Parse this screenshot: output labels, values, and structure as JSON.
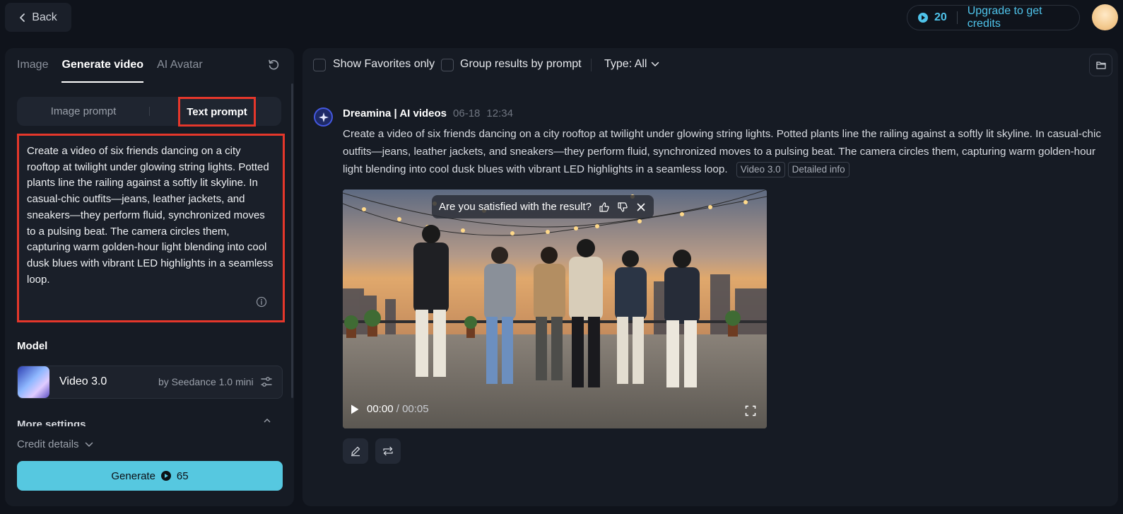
{
  "topbar": {
    "back_label": "Back",
    "credits": "20",
    "upgrade_label": "Upgrade to get credits"
  },
  "left": {
    "tabs": [
      {
        "label": "Image"
      },
      {
        "label": "Generate video"
      },
      {
        "label": "AI Avatar"
      }
    ],
    "prompt_modes": {
      "image": "Image prompt",
      "text": "Text prompt"
    },
    "prompt_value": "Create a video of six friends dancing on a city rooftop at twilight under glowing string lights. Potted plants line the railing against a softly lit skyline. In casual-chic outfits—jeans, leather jackets, and sneakers—they perform fluid, synchronized moves to a pulsing beat. The camera circles them, capturing warm golden-hour light blending into cool dusk blues with vibrant LED highlights in a seamless loop.",
    "model_label": "Model",
    "model": {
      "name": "Video 3.0",
      "by": "by Seedance 1.0 mini"
    },
    "more_settings": "More settings",
    "credit_details": "Credit details",
    "generate_label": "Generate",
    "generate_cost": "65"
  },
  "right": {
    "filters": {
      "favorites": "Show Favorites only",
      "group": "Group results by prompt",
      "type": "Type: All"
    },
    "post": {
      "author": "Dreamina | AI videos",
      "date": "06-18",
      "time": "12:34",
      "text": "Create a video of six friends dancing on a city rooftop at twilight under glowing string lights. Potted plants line the railing against a softly lit skyline. In casual-chic outfits—jeans, leather jackets, and sneakers—they perform fluid, synchronized moves to a pulsing beat. The camera circles them, capturing warm golden-hour light blending into cool dusk blues with vibrant LED highlights in a seamless loop.",
      "tag_model": "Video 3.0",
      "tag_info": "Detailed info"
    },
    "video": {
      "feedback_question": "Are you satisfied with the result?",
      "time_current": "00:00",
      "time_sep": " / ",
      "time_total": "00:05"
    }
  },
  "colors": {
    "accent": "#4fc3ea",
    "generate_bg": "#56c8e0",
    "highlight_border": "#e5372b",
    "background": "#0f131b",
    "panel": "#161b24"
  },
  "icons": {
    "back": "chevron-left-icon",
    "credit": "credit-coin-icon",
    "refresh": "refresh-icon",
    "info": "info-icon",
    "settings": "sliders-icon",
    "folder": "folder-icon",
    "thumbs_up": "thumbs-up-icon",
    "thumbs_down": "thumbs-down-icon",
    "close": "close-icon",
    "play": "play-icon",
    "fullscreen": "fullscreen-icon",
    "edit": "pencil-icon",
    "regenerate": "repeat-icon"
  }
}
